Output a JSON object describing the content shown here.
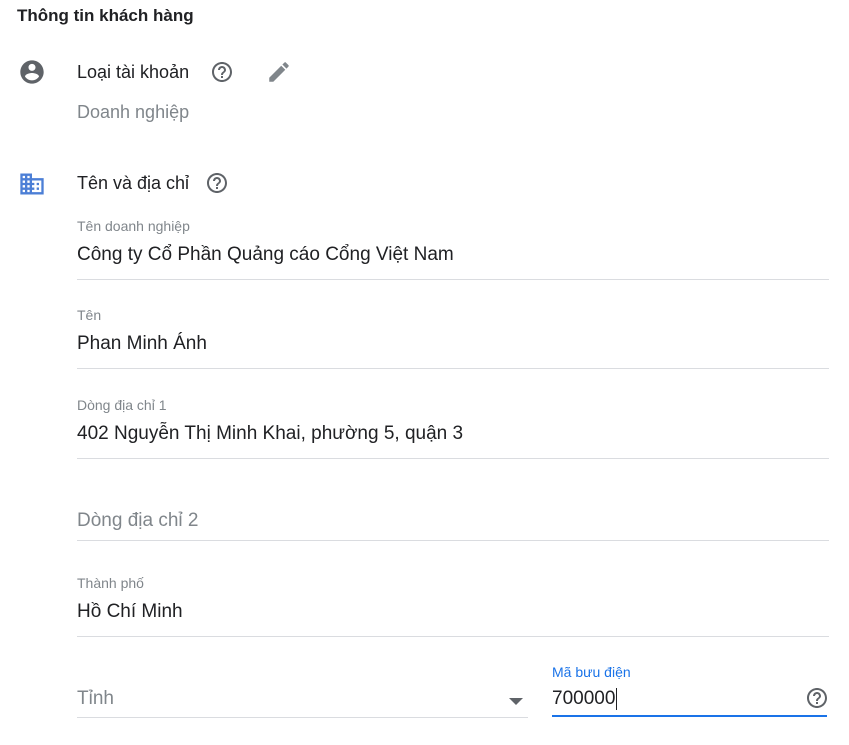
{
  "section_title": "Thông tin khách hàng",
  "account": {
    "title": "Loại tài khoản",
    "value": "Doanh nghiệp",
    "icons": {
      "avatar": "account-circle-icon",
      "help": "help-icon",
      "edit": "pencil-icon"
    }
  },
  "name_address": {
    "title": "Tên và địa chỉ",
    "icons": {
      "building": "business-building-icon",
      "help": "help-icon"
    },
    "fields": {
      "business_name": {
        "label": "Tên doanh nghiệp",
        "value": "Công ty Cổ Phần Quảng cáo Cổng Việt Nam"
      },
      "name": {
        "label": "Tên",
        "value": "Phan Minh Ánh"
      },
      "address1": {
        "label": "Dòng địa chỉ 1",
        "value": "402 Nguyễn Thị Minh Khai, phường 5, quận 3"
      },
      "address2": {
        "placeholder": "Dòng địa chỉ 2"
      },
      "city": {
        "label": "Thành phố",
        "value": "Hồ Chí Minh"
      },
      "province": {
        "placeholder": "Tỉnh",
        "icon": "dropdown-arrow-icon"
      },
      "postal": {
        "label": "Mã bưu điện",
        "value": "700000",
        "icon": "help-icon"
      }
    }
  },
  "colors": {
    "accent": "#1a73e8",
    "icon_gray": "#5f6368",
    "building_blue": "#4c7fd6",
    "muted_text": "#80868b"
  }
}
